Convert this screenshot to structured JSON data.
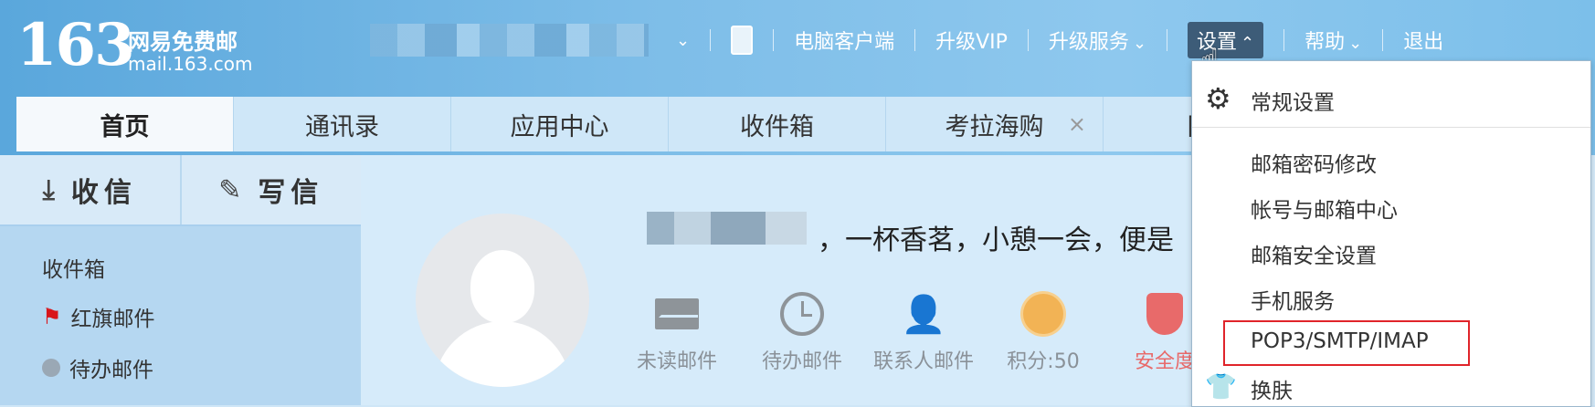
{
  "brand": {
    "number": "163",
    "name_cn": "网易免费邮",
    "domain": "mail.163.com"
  },
  "topnav": {
    "client": "电脑客户端",
    "vip": "升级VIP",
    "services": "升级服务",
    "settings": "设置",
    "help": "帮助",
    "logout": "退出"
  },
  "tabs": [
    {
      "label": "首页",
      "active": true
    },
    {
      "label": "通讯录"
    },
    {
      "label": "应用中心"
    },
    {
      "label": "收件箱"
    },
    {
      "label": "考拉海购",
      "closable": true
    },
    {
      "label": "网易"
    }
  ],
  "quick_actions": {
    "receive": "收信",
    "compose": "写信"
  },
  "folders": [
    "收件箱",
    "红旗邮件",
    "待办邮件"
  ],
  "welcome": {
    "greeting": "，一杯香茗，小憩一会，便是"
  },
  "stats": [
    {
      "label": "未读邮件",
      "icon": "envelope-icon"
    },
    {
      "label": "待办邮件",
      "icon": "clock-icon"
    },
    {
      "label": "联系人邮件",
      "icon": "contact-star-icon"
    },
    {
      "label": "积分:50",
      "icon": "points-icon"
    },
    {
      "label": "安全度",
      "icon": "shield-icon",
      "color": "#e86a6a"
    }
  ],
  "settings_menu": {
    "general": "常规设置",
    "items": [
      "邮箱密码修改",
      "帐号与邮箱中心",
      "邮箱安全设置",
      "手机服务",
      "POP3/SMTP/IMAP"
    ],
    "skin": "换肤",
    "highlighted": "POP3/SMTP/IMAP",
    "highlight_color": "#e0242a"
  }
}
